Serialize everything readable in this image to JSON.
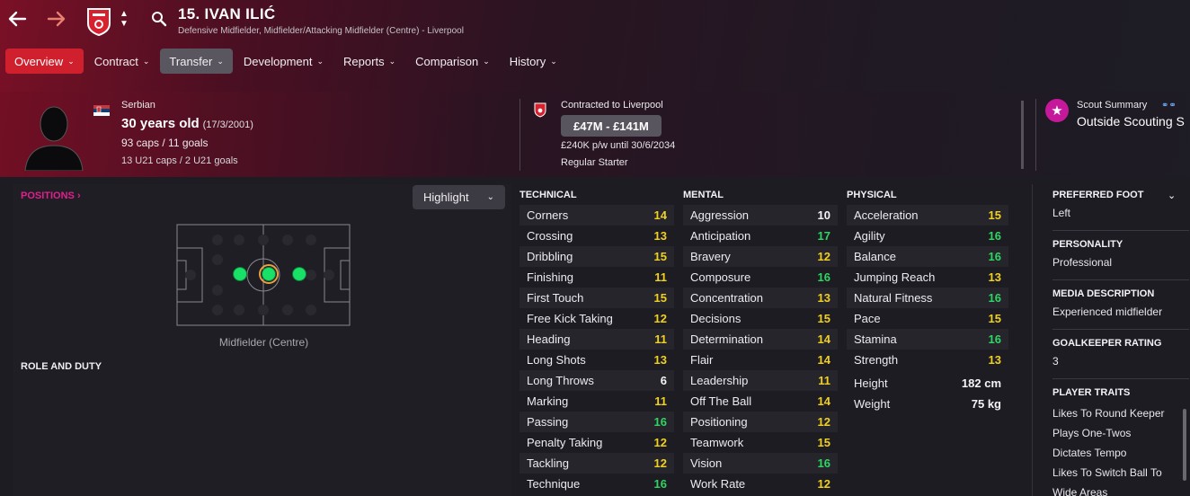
{
  "header": {
    "title": "15. IVAN ILIĆ",
    "subtitle": "Defensive Midfielder, Midfielder/Attacking Midfielder (Centre) - Liverpool",
    "back_icon": "arrow-left-icon",
    "forward_icon": "arrow-right-icon"
  },
  "tabs": [
    {
      "label": "Overview",
      "state": "active"
    },
    {
      "label": "Contract"
    },
    {
      "label": "Transfer",
      "state": "selected"
    },
    {
      "label": "Development"
    },
    {
      "label": "Reports"
    },
    {
      "label": "Comparison"
    },
    {
      "label": "History"
    }
  ],
  "profile": {
    "nationality": "Serbian",
    "age": "30 years old",
    "dob": "(17/3/2001)",
    "caps": "93 caps / 11 goals",
    "u21": "13 U21 caps / 2 U21 goals"
  },
  "contract": {
    "club_line": "Contracted to Liverpool",
    "value": "£47M - £141M",
    "wage": "£240K p/w until 30/6/2034",
    "status": "Regular Starter"
  },
  "scout": {
    "label": "Scout Summary",
    "value": "Outside Scouting S"
  },
  "positions": {
    "label": "POSITIONS",
    "highlight_label": "Highlight",
    "position_name": "Midfielder (Centre)",
    "role_duty_label": "ROLE AND DUTY"
  },
  "attributes": {
    "technical": {
      "title": "TECHNICAL",
      "rows": [
        {
          "name": "Corners",
          "value": "14",
          "tone": "y"
        },
        {
          "name": "Crossing",
          "value": "13",
          "tone": "y"
        },
        {
          "name": "Dribbling",
          "value": "15",
          "tone": "y"
        },
        {
          "name": "Finishing",
          "value": "11",
          "tone": "y"
        },
        {
          "name": "First Touch",
          "value": "15",
          "tone": "y"
        },
        {
          "name": "Free Kick Taking",
          "value": "12",
          "tone": "y"
        },
        {
          "name": "Heading",
          "value": "11",
          "tone": "y"
        },
        {
          "name": "Long Shots",
          "value": "13",
          "tone": "y"
        },
        {
          "name": "Long Throws",
          "value": "6",
          "tone": "w"
        },
        {
          "name": "Marking",
          "value": "11",
          "tone": "y"
        },
        {
          "name": "Passing",
          "value": "16",
          "tone": "g"
        },
        {
          "name": "Penalty Taking",
          "value": "12",
          "tone": "y"
        },
        {
          "name": "Tackling",
          "value": "12",
          "tone": "y"
        },
        {
          "name": "Technique",
          "value": "16",
          "tone": "g"
        }
      ]
    },
    "mental": {
      "title": "MENTAL",
      "rows": [
        {
          "name": "Aggression",
          "value": "10",
          "tone": "w"
        },
        {
          "name": "Anticipation",
          "value": "17",
          "tone": "g"
        },
        {
          "name": "Bravery",
          "value": "12",
          "tone": "y"
        },
        {
          "name": "Composure",
          "value": "16",
          "tone": "g"
        },
        {
          "name": "Concentration",
          "value": "13",
          "tone": "y"
        },
        {
          "name": "Decisions",
          "value": "15",
          "tone": "y"
        },
        {
          "name": "Determination",
          "value": "14",
          "tone": "y"
        },
        {
          "name": "Flair",
          "value": "14",
          "tone": "y"
        },
        {
          "name": "Leadership",
          "value": "11",
          "tone": "y"
        },
        {
          "name": "Off The Ball",
          "value": "14",
          "tone": "y"
        },
        {
          "name": "Positioning",
          "value": "12",
          "tone": "y"
        },
        {
          "name": "Teamwork",
          "value": "15",
          "tone": "y"
        },
        {
          "name": "Vision",
          "value": "16",
          "tone": "g"
        },
        {
          "name": "Work Rate",
          "value": "12",
          "tone": "y"
        }
      ]
    },
    "physical": {
      "title": "PHYSICAL",
      "rows": [
        {
          "name": "Acceleration",
          "value": "15",
          "tone": "y"
        },
        {
          "name": "Agility",
          "value": "16",
          "tone": "g"
        },
        {
          "name": "Balance",
          "value": "16",
          "tone": "g"
        },
        {
          "name": "Jumping Reach",
          "value": "13",
          "tone": "y"
        },
        {
          "name": "Natural Fitness",
          "value": "16",
          "tone": "g"
        },
        {
          "name": "Pace",
          "value": "15",
          "tone": "y"
        },
        {
          "name": "Stamina",
          "value": "16",
          "tone": "g"
        },
        {
          "name": "Strength",
          "value": "13",
          "tone": "y"
        }
      ],
      "extra": [
        {
          "name": "Height",
          "value": "182 cm"
        },
        {
          "name": "Weight",
          "value": "75 kg"
        }
      ]
    }
  },
  "details": {
    "preferred_foot_label": "PREFERRED FOOT",
    "preferred_foot": "Left",
    "personality_label": "PERSONALITY",
    "personality": "Professional",
    "media_label": "MEDIA DESCRIPTION",
    "media": "Experienced midfielder",
    "gk_label": "GOALKEEPER RATING",
    "gk": "3",
    "traits_label": "PLAYER TRAITS",
    "traits": [
      "Likes To Round Keeper",
      "Plays One-Twos",
      "Dictates Tempo",
      "Likes To Switch Ball To",
      "Wide Areas"
    ]
  },
  "colors": {
    "accent": "#d0202e",
    "good": "#2fd562",
    "medium": "#f0d021",
    "positions_label": "#e0208e",
    "scout_badge": "#c6189a"
  }
}
